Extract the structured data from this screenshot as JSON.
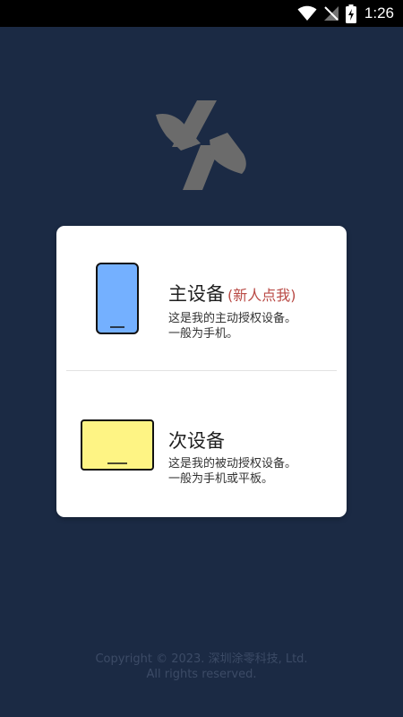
{
  "status_bar": {
    "time": "1:26",
    "icons": [
      "wifi-icon",
      "no-signal-icon",
      "battery-charging-icon"
    ]
  },
  "logo": {
    "icon": "app-logo"
  },
  "options": {
    "primary": {
      "title": "主设备",
      "tag": "(新人点我)",
      "desc_line1": "这是我的主动授权设备。",
      "desc_line2": "一般为手机。",
      "icon": "phone-icon",
      "icon_color": "#74b0ff"
    },
    "secondary": {
      "title": "次设备",
      "desc_line1": "这是我的被动授权设备。",
      "desc_line2": "一般为手机或平板。",
      "icon": "tablet-icon",
      "icon_color": "#fef484"
    }
  },
  "footer": {
    "line1": "Copyright © 2023. 深圳涂零科技, Ltd.",
    "line2": "All rights reserved."
  },
  "colors": {
    "background": "#1b2a44",
    "card": "#ffffff",
    "tag": "#b94a45",
    "footer_text": "#3c4b66"
  }
}
